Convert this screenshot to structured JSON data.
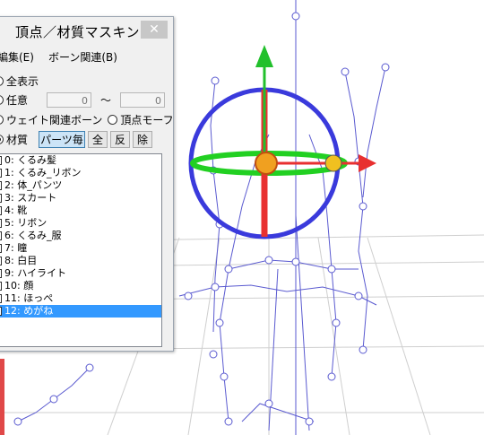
{
  "dialog": {
    "title": "頂点／材質マスキング",
    "close_label": "✕",
    "menu": [
      "編集(E)",
      "ボーン関連(B)"
    ],
    "options": {
      "show_all": "全表示",
      "arbitrary": "任意",
      "range_from": "0",
      "range_sep": "～",
      "range_to": "0",
      "weight_bone": "ウェイト関連ボーン",
      "vertex_morph": "頂点モーフ",
      "material": "材質",
      "per_part": "パーツ毎",
      "all": "全",
      "invert": "反",
      "remove": "除"
    },
    "materials": [
      {
        "label": "0: くるみ髪",
        "checked": false,
        "selected": false
      },
      {
        "label": "1: くるみ_リボン",
        "checked": false,
        "selected": false
      },
      {
        "label": "2: 体_パンツ",
        "checked": false,
        "selected": false
      },
      {
        "label": "3: スカート",
        "checked": false,
        "selected": false
      },
      {
        "label": "4: 靴",
        "checked": false,
        "selected": false
      },
      {
        "label": "5: リボン",
        "checked": false,
        "selected": false
      },
      {
        "label": "6: くるみ_服",
        "checked": false,
        "selected": false
      },
      {
        "label": "7: 瞳",
        "checked": true,
        "selected": false
      },
      {
        "label": "8: 白目",
        "checked": false,
        "selected": false
      },
      {
        "label": "9: ハイライト",
        "checked": false,
        "selected": false
      },
      {
        "label": "10: 顔",
        "checked": false,
        "selected": false
      },
      {
        "label": "11: ほっぺ",
        "checked": false,
        "selected": false
      },
      {
        "label": "12: めがね",
        "checked": false,
        "selected": true
      }
    ]
  },
  "colors": {
    "gizmo_ring": "#3a3adc",
    "axis_x": "#e83030",
    "axis_y": "#22c02c",
    "axis_z": "#22d022",
    "bone": "#5a5ad0",
    "grid": "#cfcfcf",
    "selection": "#3399ff"
  }
}
